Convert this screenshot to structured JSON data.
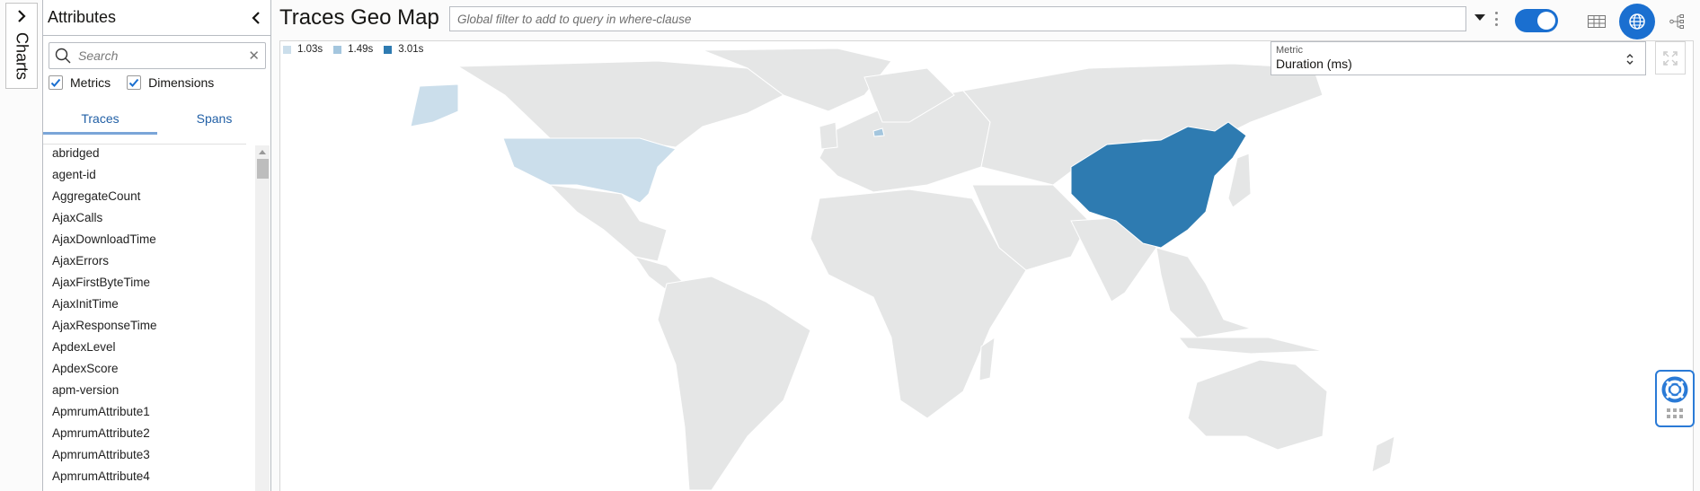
{
  "charts_rail": {
    "label": "Charts",
    "expand_icon": "chevron-right-icon"
  },
  "attributes": {
    "title": "Attributes",
    "collapse_icon": "chevron-left-icon",
    "search": {
      "placeholder": "Search",
      "value": ""
    },
    "filters": [
      {
        "label": "Metrics",
        "checked": true
      },
      {
        "label": "Dimensions",
        "checked": true
      }
    ],
    "tabs": [
      {
        "label": "Traces",
        "active": true
      },
      {
        "label": "Spans",
        "active": false
      }
    ],
    "items": [
      "abridged",
      "agent-id",
      "AggregateCount",
      "AjaxCalls",
      "AjaxDownloadTime",
      "AjaxErrors",
      "AjaxFirstByteTime",
      "AjaxInitTime",
      "AjaxResponseTime",
      "ApdexLevel",
      "ApdexScore",
      "apm-version",
      "ApmrumAttribute1",
      "ApmrumAttribute2",
      "ApmrumAttribute3",
      "ApmrumAttribute4"
    ]
  },
  "main": {
    "title": "Traces Geo Map",
    "filter": {
      "placeholder": "Global filter to add to query in where-clause",
      "value": ""
    },
    "toggle_on": true,
    "views": [
      {
        "name": "table-view",
        "icon": "table-icon",
        "active": false
      },
      {
        "name": "geo-map-view",
        "icon": "globe-icon",
        "active": true
      },
      {
        "name": "topology-view",
        "icon": "topology-icon",
        "active": false
      }
    ]
  },
  "map": {
    "metric": {
      "label": "Metric",
      "value": "Duration (ms)"
    },
    "colors": {
      "base": "#e5e6e6",
      "low": "#cbdeeb",
      "mid": "#a4c6de",
      "high": "#2e7bb1",
      "border": "#ffffff"
    },
    "legend": [
      {
        "label": "1.03s",
        "color": "#cbdeeb"
      },
      {
        "label": "1.49s",
        "color": "#a4c6de"
      },
      {
        "label": "3.01s",
        "color": "#2e7bb1"
      }
    ],
    "highlighted_regions": [
      {
        "country": "United States",
        "value": "1.03s"
      },
      {
        "country": "Netherlands",
        "value": "1.49s"
      },
      {
        "country": "China",
        "value": "3.01s"
      }
    ]
  },
  "help_widget": {
    "icon": "lifebuoy-icon"
  }
}
